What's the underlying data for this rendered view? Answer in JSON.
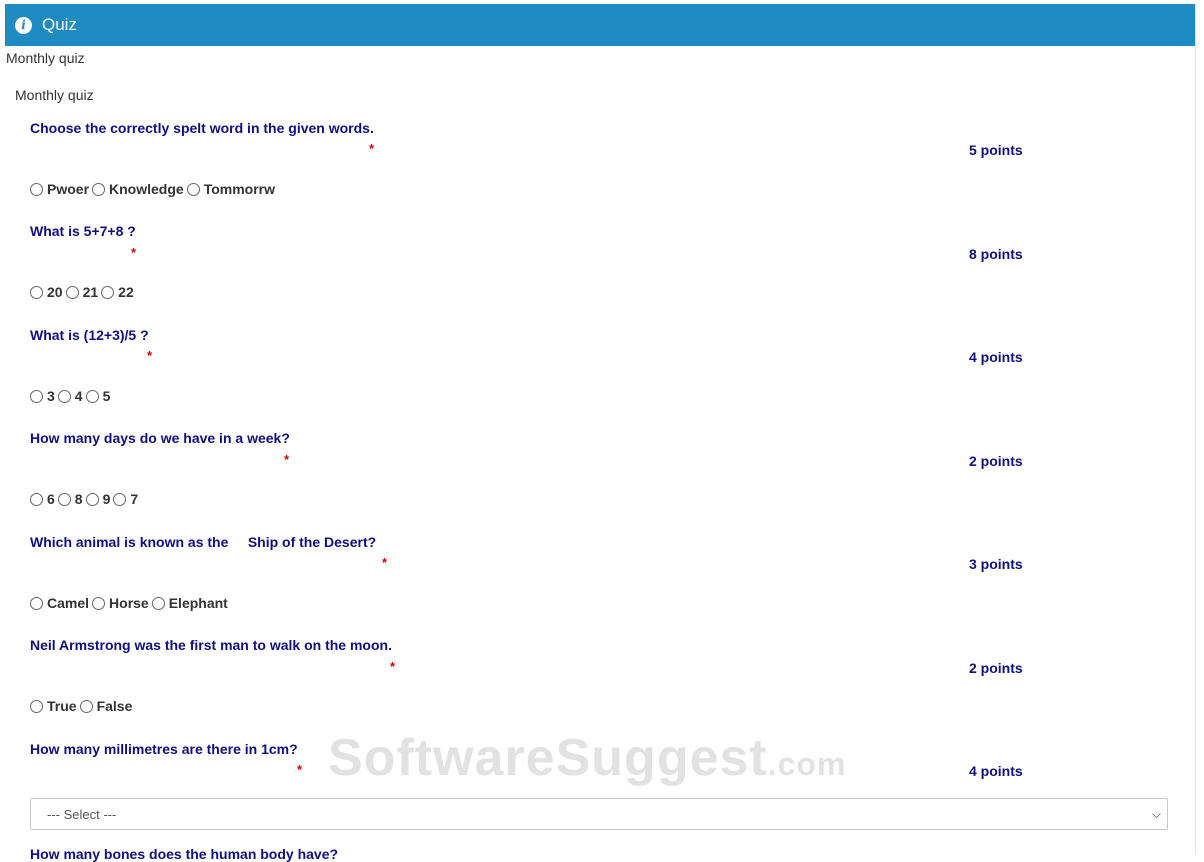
{
  "header": {
    "title": "Quiz",
    "icon": "info-icon",
    "color": "#1e8bc3"
  },
  "quiz": {
    "description": "Monthly quiz",
    "subtitle": "Monthly quiz",
    "required_marker": "*",
    "questions": [
      {
        "text": "Choose the correctly spelt word in the given words.",
        "points": "5 points",
        "options": [
          "Pwoer",
          "Knowledge",
          "Tommorrw"
        ]
      },
      {
        "text": "What is 5+7+8 ?",
        "points": "8 points",
        "options": [
          "20",
          "21",
          "22"
        ]
      },
      {
        "text": "What is (12+3)/5 ?",
        "points": "4 points",
        "options": [
          "3",
          "4",
          "5"
        ]
      },
      {
        "text": "How many days do we have in a week?",
        "points": "2 points",
        "options": [
          "6",
          "8",
          "9",
          "7"
        ]
      },
      {
        "text": "Which animal is known as the     Ship of the Desert?",
        "points": "3 points",
        "options": [
          "Camel",
          "Horse",
          "Elephant"
        ]
      },
      {
        "text": "Neil Armstrong was the first man to walk on the moon.",
        "points": "2 points",
        "options": [
          "True",
          "False"
        ]
      },
      {
        "text": "How many millimetres are there in 1cm?",
        "points": "4 points",
        "select_value": "--- Select ---"
      }
    ],
    "next_question_partial": "How many bones does the human body have?"
  },
  "watermark": {
    "main": "SoftwareSuggest",
    "suffix": ".com"
  }
}
